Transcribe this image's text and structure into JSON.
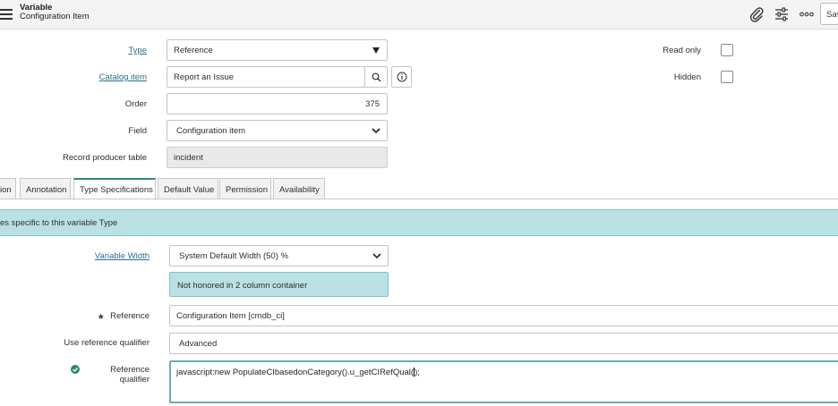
{
  "header": {
    "title": "Variable",
    "subtitle": "Configuration Item",
    "save_label": "Save",
    "icons": [
      "menu-icon",
      "attachment-icon",
      "settings-sliders-icon",
      "more-icon"
    ]
  },
  "form": {
    "type": {
      "label": "Type",
      "value": "Reference"
    },
    "catalog_item": {
      "label": "Catalog item",
      "value": "Report an Issue"
    },
    "order": {
      "label": "Order",
      "value": "375"
    },
    "field": {
      "label": "Field",
      "value": "Configuration item"
    },
    "record_producer_table": {
      "label": "Record producer table",
      "value": "incident"
    },
    "read_only": {
      "label": "Read only",
      "checked": false
    },
    "hidden": {
      "label": "Hidden",
      "checked": false
    }
  },
  "tabs": [
    {
      "label": "ion",
      "active": false
    },
    {
      "label": "Annotation",
      "active": false
    },
    {
      "label": "Type Specifications",
      "active": true
    },
    {
      "label": "Default Value",
      "active": false
    },
    {
      "label": "Permission",
      "active": false
    },
    {
      "label": "Availability",
      "active": false
    }
  ],
  "type_spec": {
    "banner": "es specific to this variable Type",
    "variable_width": {
      "label": "Variable Width",
      "value": "System Default Width (50) %"
    },
    "notice": "Not honored in 2 column container",
    "reference": {
      "label": "Reference",
      "value": "Configuration Item [cmdb_ci]"
    },
    "use_reference_qualifier": {
      "label": "Use reference qualifier",
      "value": "Advanced"
    },
    "reference_qualifier": {
      "label": "Reference qualifier",
      "value_before_cursor": "javascript:new PopulateCIbasedonCategory().u_getCIRefQual(",
      "value_after_cursor": ");"
    }
  },
  "colors": {
    "accent": "#2b8a6e",
    "link": "#2b6e8a",
    "banner_bg": "#b9e1e4"
  }
}
